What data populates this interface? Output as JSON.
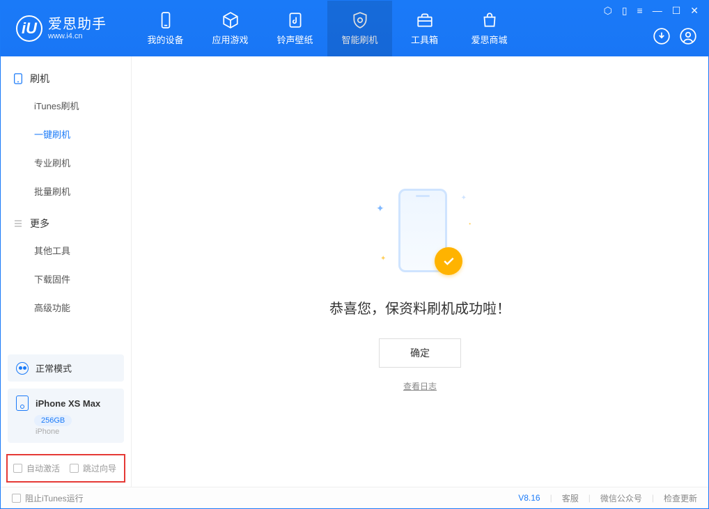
{
  "app": {
    "title": "爱思助手",
    "subtitle": "www.i4.cn",
    "logo_letter": "iU"
  },
  "nav": [
    {
      "label": "我的设备"
    },
    {
      "label": "应用游戏"
    },
    {
      "label": "铃声壁纸"
    },
    {
      "label": "智能刷机"
    },
    {
      "label": "工具箱"
    },
    {
      "label": "爱思商城"
    }
  ],
  "sidebar": {
    "section_flash": "刷机",
    "section_more": "更多",
    "flash_items": [
      "iTunes刷机",
      "一键刷机",
      "专业刷机",
      "批量刷机"
    ],
    "more_items": [
      "其他工具",
      "下载固件",
      "高级功能"
    ],
    "mode": "正常模式",
    "device": {
      "name": "iPhone XS Max",
      "capacity": "256GB",
      "type": "iPhone"
    },
    "checks": {
      "auto_activate": "自动激活",
      "skip_wizard": "跳过向导"
    }
  },
  "main": {
    "success_text": "恭喜您，保资料刷机成功啦！",
    "ok": "确定",
    "log_link": "查看日志"
  },
  "footer": {
    "block_itunes": "阻止iTunes运行",
    "version": "V8.16",
    "support": "客服",
    "wechat": "微信公众号",
    "update": "检查更新"
  }
}
